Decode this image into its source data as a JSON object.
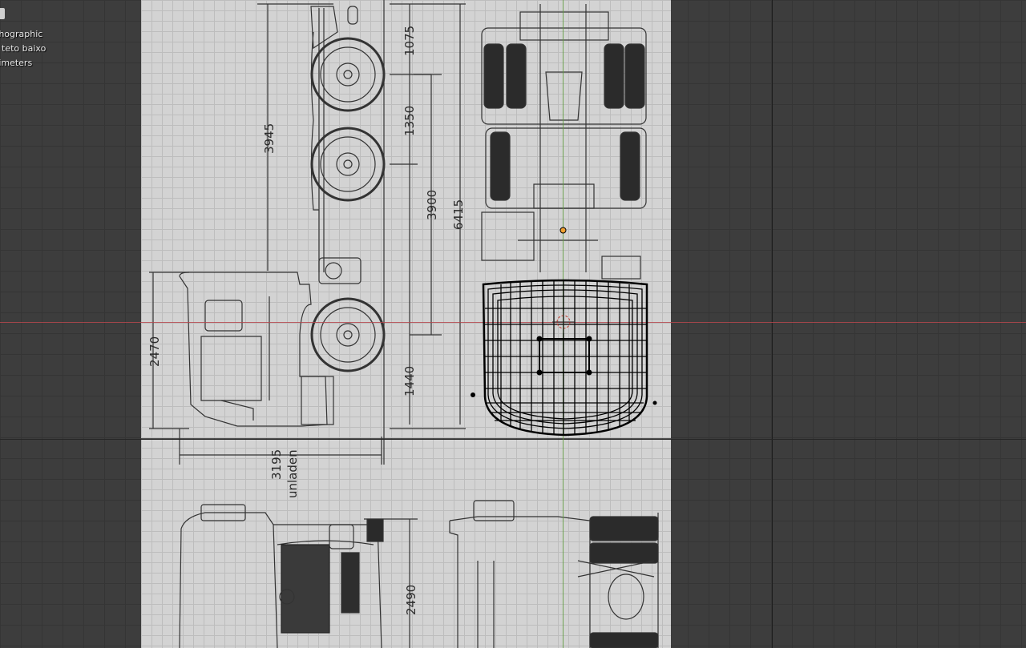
{
  "viewport": {
    "overlay": {
      "line1": "thographic",
      "line2": "r teto baixo",
      "line3": "timeters"
    }
  },
  "blueprint": {
    "dimensions": {
      "d1075": "1075",
      "d1350": "1350",
      "d3945": "3945",
      "d3900": "3900",
      "d6415": "6415",
      "d2470": "2470",
      "d1440": "1440",
      "d3195": "3195",
      "unladen": "unladen",
      "d2490": "2490"
    }
  },
  "colors": {
    "x_axis": "#b5474e",
    "y_axis": "#5d9a3c",
    "viewport_bg": "#3d3d3d",
    "blueprint_bg": "#d3d3d3"
  }
}
